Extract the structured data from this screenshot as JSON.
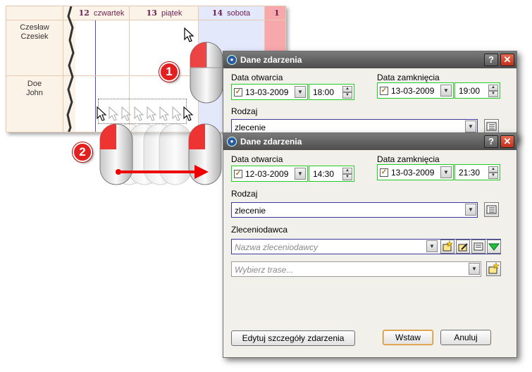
{
  "calendar": {
    "days": [
      {
        "num": "12",
        "name": "czwartek"
      },
      {
        "num": "13",
        "name": "piątek"
      },
      {
        "num": "14",
        "name": "sobota"
      },
      {
        "num": "1"
      }
    ],
    "people": [
      {
        "first": "Czesław",
        "last": "Czesiek"
      },
      {
        "first": "Doe",
        "last": "John"
      }
    ]
  },
  "callouts": [
    "1",
    "2"
  ],
  "dialog1": {
    "title": "Dane zdarzenia",
    "help": "?",
    "close": "✕",
    "open_label": "Data otwarcia",
    "close_label": "Data zamknięcia",
    "open_date": "13-03-2009",
    "open_time": "18:00",
    "close_date": "13-03-2009",
    "close_time": "19:00",
    "rodzaj_label": "Rodzaj",
    "rodzaj_value": "zlecenie"
  },
  "dialog2": {
    "title": "Dane zdarzenia",
    "help": "?",
    "close": "✕",
    "open_label": "Data otwarcia",
    "close_label": "Data zamknięcia",
    "open_date": "12-03-2009",
    "open_time": "14:30",
    "close_date": "13-03-2009",
    "close_time": "21:30",
    "rodzaj_label": "Rodzaj",
    "rodzaj_value": "zlecenie",
    "zleceniodawca_label": "Zleceniodawca",
    "zleceniodawca_placeholder": "Nazwa zleceniodawcy",
    "trasa_placeholder": "Wybierz trase...",
    "edit_button": "Edytuj szczegóły zdarzenia",
    "insert_button": "Wstaw",
    "cancel_button": "Anuluj"
  },
  "colors": {
    "titlebar": "#5a5a5a",
    "close_red": "#d8412a",
    "field_green": "#22cc22",
    "field_blue": "#3a3a9a",
    "calendar_bg": "#fbf2e8",
    "weekend_blue": "#e4e8fb",
    "callout_red": "#e22020"
  }
}
